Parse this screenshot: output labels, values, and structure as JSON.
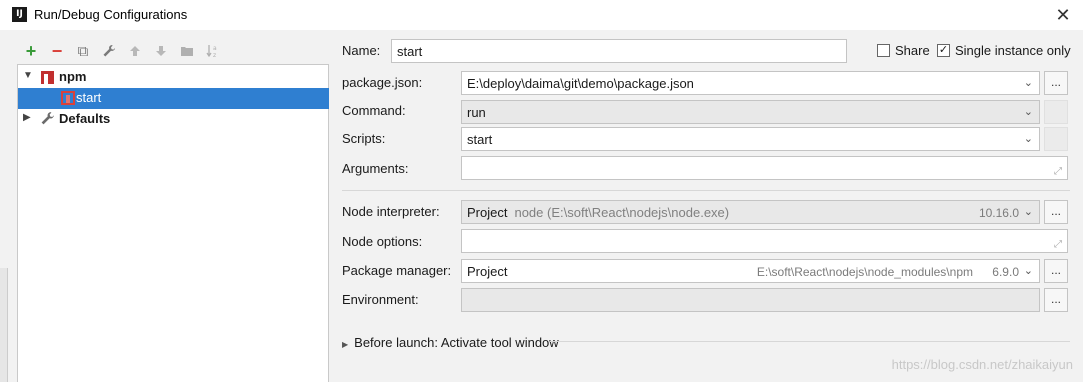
{
  "window": {
    "title": "Run/Debug Configurations",
    "app_icon_text": "IJ"
  },
  "toolbar": {
    "add": "+",
    "remove": "−",
    "copy": "⧉",
    "edit": "🔧",
    "up": "⬆",
    "down": "⬇",
    "folder": "▆",
    "sort": "↓a"
  },
  "tree": {
    "npm": {
      "label": "npm"
    },
    "start": {
      "label": "start"
    },
    "defaults": {
      "label": "Defaults"
    }
  },
  "form": {
    "name": {
      "label": "Name:",
      "value": "start"
    },
    "share": {
      "label": "Share",
      "checked": false
    },
    "single_instance": {
      "label": "Single instance only",
      "checked": true
    },
    "package_json": {
      "label": "package.json:",
      "value": "E:\\deploy\\daima\\git\\demo\\package.json"
    },
    "command": {
      "label": "Command:",
      "value": "run"
    },
    "scripts": {
      "label": "Scripts:",
      "value": "start"
    },
    "arguments": {
      "label": "Arguments:",
      "value": ""
    },
    "node_interpreter": {
      "label": "Node interpreter:",
      "prefix": "Project",
      "value": "node (E:\\soft\\React\\nodejs\\node.exe)",
      "version": "10.16.0"
    },
    "node_options": {
      "label": "Node options:",
      "value": ""
    },
    "package_manager": {
      "label": "Package manager:",
      "value": "Project",
      "path": "E:\\soft\\React\\nodejs\\node_modules\\npm",
      "version": "6.9.0"
    },
    "environment": {
      "label": "Environment:",
      "value": ""
    },
    "before_launch": {
      "label": "Before launch: Activate tool window"
    },
    "ellipsis": "..."
  },
  "watermark": "https://blog.csdn.net/zhaikaiyun"
}
